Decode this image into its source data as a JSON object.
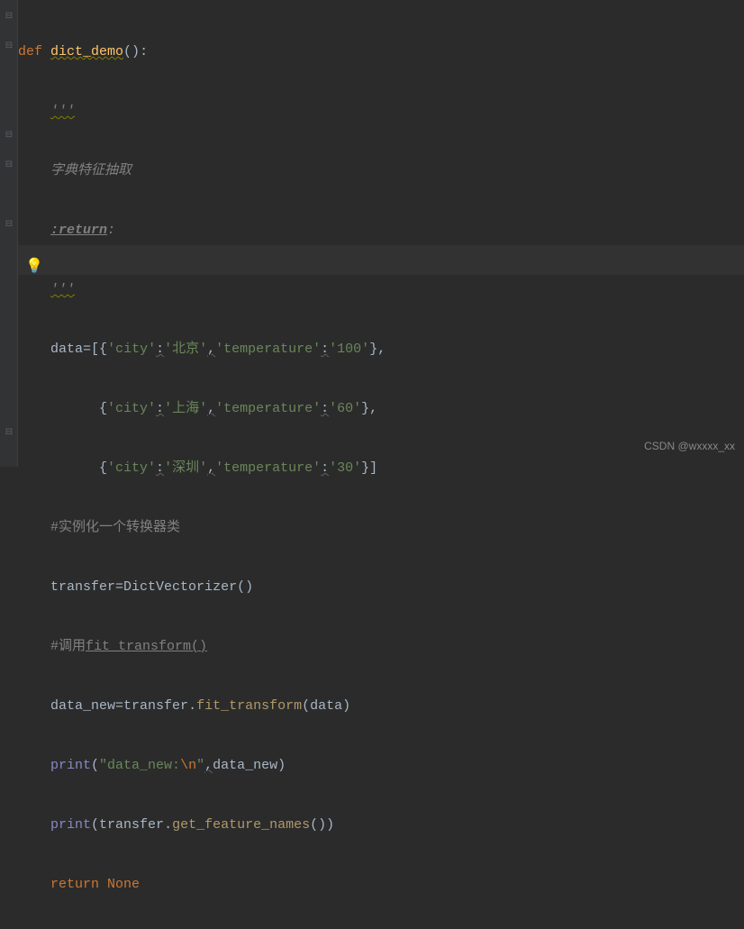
{
  "code": {
    "line1": {
      "def": "def",
      "fn": "dict_demo",
      "parens": "()",
      "colon": ":"
    },
    "line2": {
      "doc": "'''"
    },
    "line3": {
      "doc": "字典特征抽取"
    },
    "line4": {
      "doc_kw": ":return",
      "doc_colon": ":"
    },
    "line5": {
      "doc": "'''"
    },
    "line6": {
      "var": "data",
      "eq": "=",
      "lb": "[{",
      "k1q": "'city'",
      "c1": ":",
      "v1q": "'北京'",
      "cm1": ",",
      "k2q": "'temperature'",
      "c2": ":",
      "v2q": "'100'",
      "rb": "},"
    },
    "line7": {
      "lb": "{",
      "k1q": "'city'",
      "c1": ":",
      "v1q": "'上海'",
      "cm1": ",",
      "k2q": "'temperature'",
      "c2": ":",
      "v2q": "'60'",
      "rb": "},"
    },
    "line8": {
      "lb": "{",
      "k1q": "'city'",
      "c1": ":",
      "v1q": "'深圳'",
      "cm1": ",",
      "k2q": "'temperature'",
      "c2": ":",
      "v2q": "'30'",
      "rb": "}]"
    },
    "line9": {
      "comment": "#实例化一个转换器类"
    },
    "line10": {
      "var": "transfer",
      "eq": "=",
      "cls": "DictVectorizer",
      "parens": "()"
    },
    "line11": {
      "comment_pre": "#调用",
      "comment_fn": "fit_transform()"
    },
    "line12": {
      "var": "data_new",
      "eq": "=",
      "obj": "transfer",
      "dot": ".",
      "method": "fit_transform",
      "lp": "(",
      "arg": "data",
      "rp": ")"
    },
    "line13": {
      "fn": "print",
      "lp": "(",
      "str": "\"data_new:",
      "esc": "\\n",
      "strend": "\"",
      "cm": ",",
      "arg": "data_new",
      "rp": ")"
    },
    "line14": {
      "fn": "print",
      "lp": "(",
      "obj": "transfer",
      "dot": ".",
      "method": "get_feature_names",
      "pp": "()",
      "rp": ")"
    },
    "line15": {
      "ret": "return",
      "none": "None"
    }
  },
  "watermark": "CSDN @wxxxx_xx"
}
